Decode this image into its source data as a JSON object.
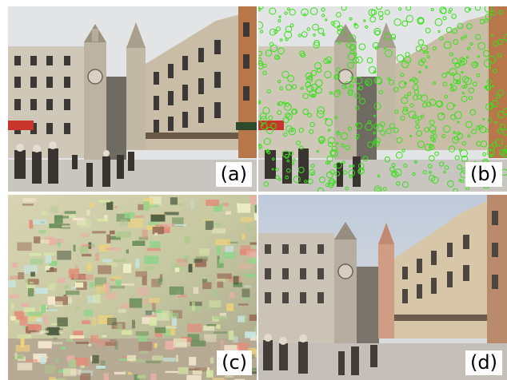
{
  "panels": [
    {
      "label": "(a)"
    },
    {
      "label": "(b)"
    },
    {
      "label": "(c)"
    },
    {
      "label": "(d)"
    }
  ],
  "colors": {
    "sky": "#e3e4e6",
    "stone_light": "#cfc7b8",
    "stone_mid": "#b6ac9a",
    "stone_dark": "#8c8272",
    "window": "#3b3835",
    "pavement": "#c9c5c0",
    "keypoint_green": "#39e01c",
    "awning_red": "#c8352b"
  }
}
